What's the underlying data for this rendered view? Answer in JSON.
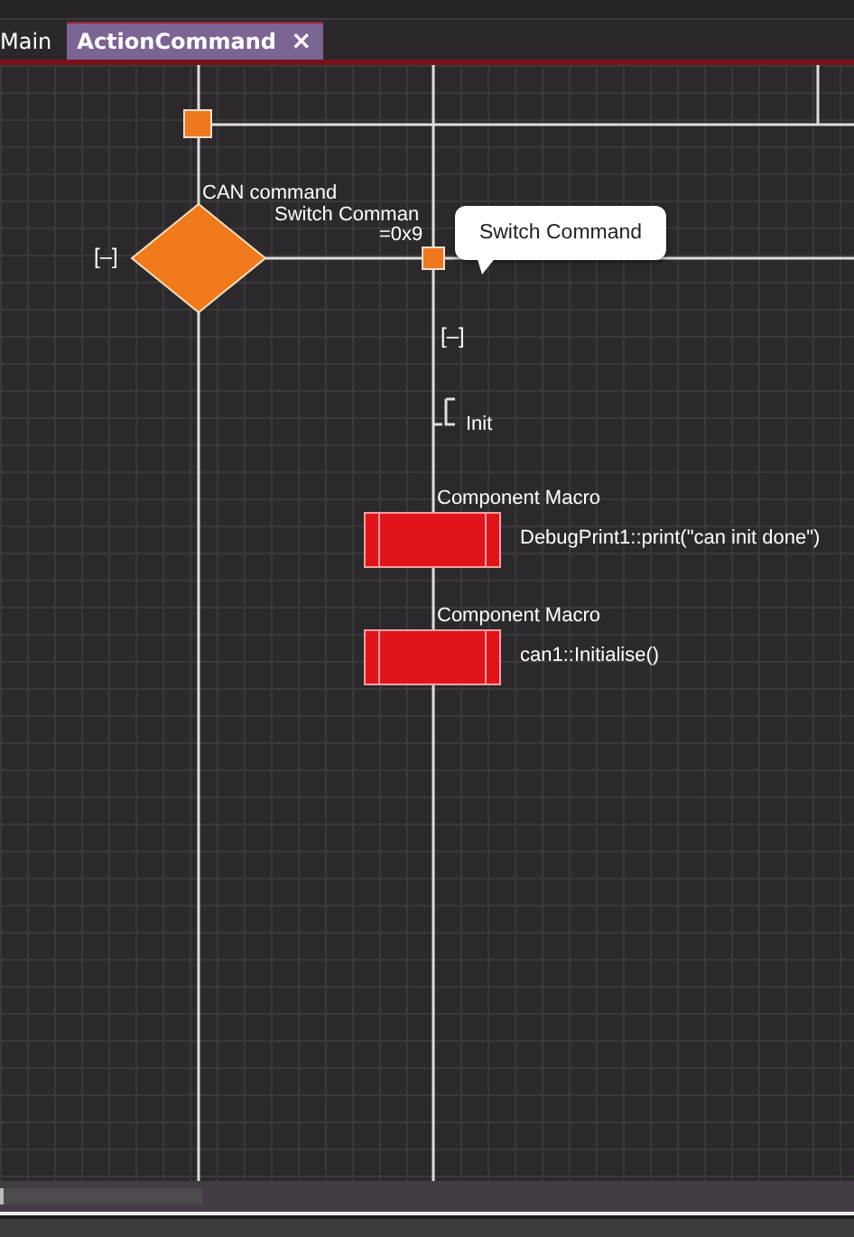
{
  "tabs": [
    {
      "label": "Main",
      "selected": false
    },
    {
      "label": "ActionCommand",
      "selected": true,
      "close": "×"
    }
  ],
  "diagram": {
    "decision": {
      "label": "CAN command",
      "collapse": "[–]"
    },
    "switch": {
      "label": "Switch Comman",
      "value": "=0x9"
    },
    "tooltip": {
      "text": "Switch Command"
    },
    "branch": {
      "collapse": "[–]",
      "case": "Init"
    },
    "macros": [
      {
        "title": "Component Macro",
        "call": "DebugPrint1::print(\"can init done\")"
      },
      {
        "title": "Component Macro",
        "call": "can1::Initialise()"
      }
    ]
  }
}
